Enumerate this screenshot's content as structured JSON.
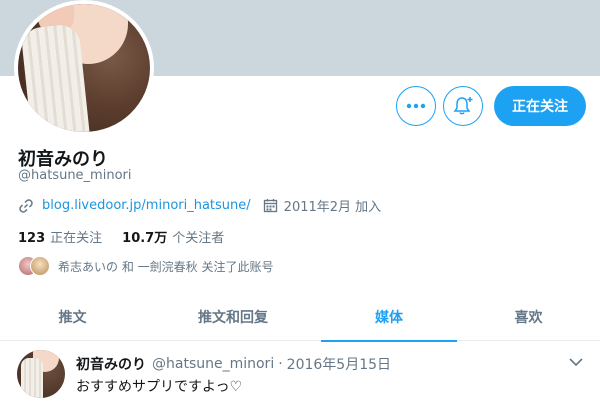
{
  "profile": {
    "display_name": "初音みのり",
    "handle": "@hatsune_minori",
    "website": "blog.livedoor.jp/minori_hatsune/",
    "joined": "2011年2月 加入"
  },
  "actions": {
    "more_icon": "more-icon",
    "notify_icon": "bell-plus-icon",
    "follow_label": "正在关注"
  },
  "stats": {
    "following_count": "123",
    "following_label": "正在关注",
    "followers_count": "10.7万",
    "followers_label": "个关注者"
  },
  "followed_by": {
    "text": "希志あいの 和 一劍浣春秋 关注了此账号"
  },
  "tabs": [
    {
      "label": "推文"
    },
    {
      "label": "推文和回复"
    },
    {
      "label": "媒体"
    },
    {
      "label": "喜欢"
    }
  ],
  "active_tab": "媒体",
  "tweet": {
    "name": "初音みのり",
    "handle": "@hatsune_minori",
    "separator": "·",
    "date": "2016年5月15日",
    "text": "おすすめサプリですよっ♡"
  },
  "colors": {
    "accent": "#1da1f2",
    "banner": "#ccd6dd",
    "secondary_text": "#657786",
    "link": "#1b95e0"
  }
}
